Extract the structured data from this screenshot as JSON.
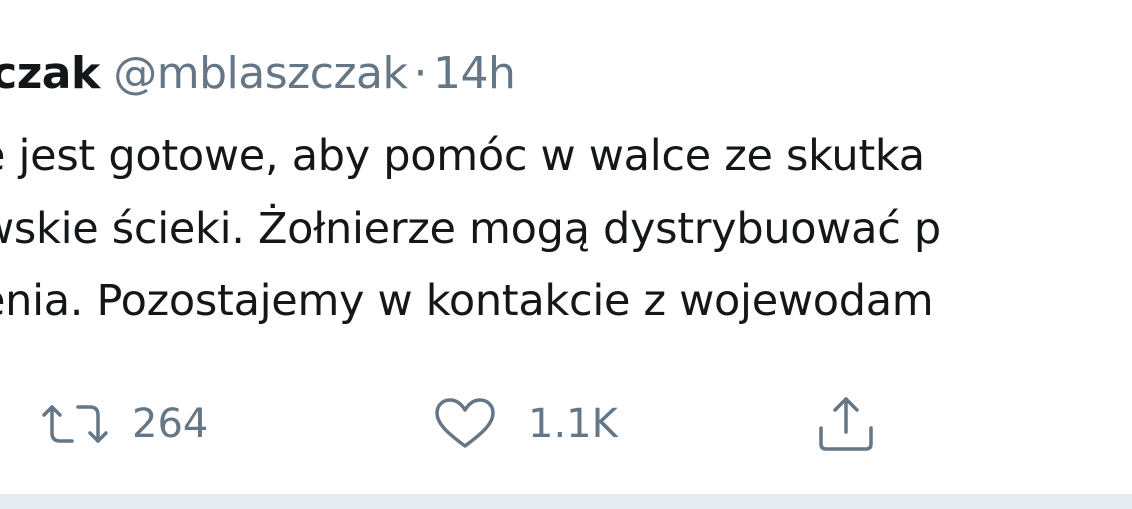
{
  "tweet": {
    "author_name": "zczak",
    "author_handle": "@mblaszczak",
    "separator": "·",
    "timestamp": "14h",
    "lines": [
      "e jest gotowe, aby pomóc w walce ze skutka",
      "wskie ścieki. Żołnierze mogą dystrybuować p",
      "enia. Pozostajemy w kontakcie z wojewodam"
    ]
  },
  "actions": {
    "retweet_count": "264",
    "like_count": "1.1K"
  },
  "colors": {
    "text": "#14171a",
    "muted": "#657786",
    "divider": "#e6ecf0"
  },
  "icons": {
    "retweet": "retweet-icon",
    "like": "heart-icon",
    "share": "share-icon"
  }
}
